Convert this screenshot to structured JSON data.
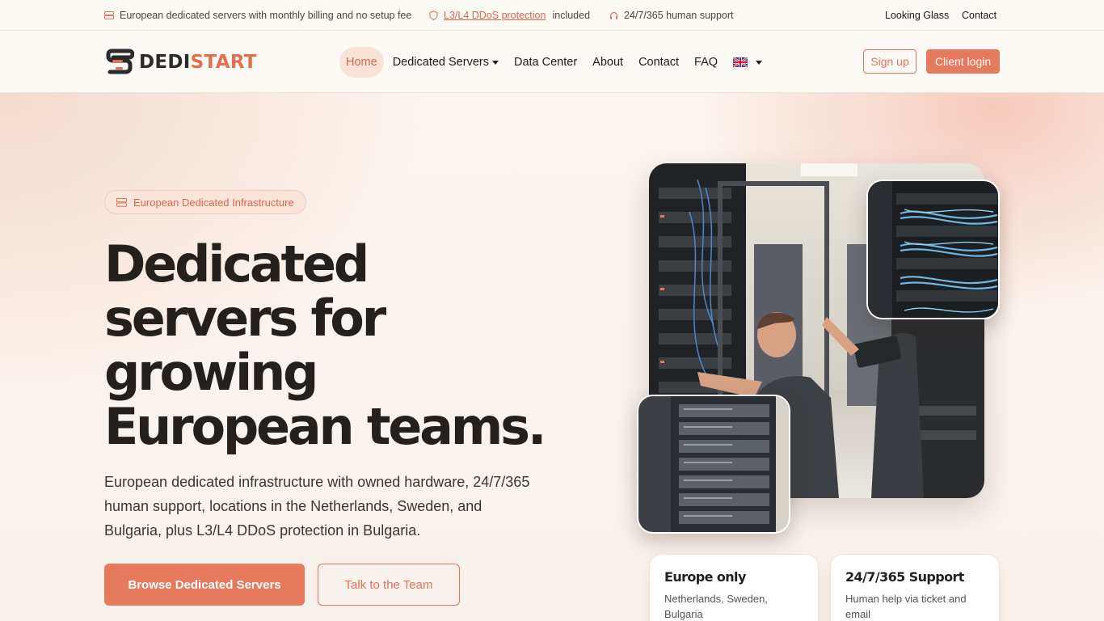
{
  "topbar": {
    "item1": "European dedicated servers with monthly billing and no setup fee",
    "ddos_link": "L3/L4 DDoS protection",
    "ddos_suffix": "included",
    "support": "24/7/365 human support",
    "looking_glass": "Looking Glass",
    "contact": "Contact"
  },
  "logo": {
    "part1": "DEDI",
    "part2": "START"
  },
  "nav": {
    "home": "Home",
    "dedicated_servers": "Dedicated Servers",
    "data_center": "Data Center",
    "about": "About",
    "contact": "Contact",
    "faq": "FAQ",
    "language_icon": "uk-flag-icon"
  },
  "auth": {
    "signup": "Sign up",
    "login": "Client login"
  },
  "hero": {
    "badge": "European Dedicated Infrastructure",
    "headline_line1": "Dedicated",
    "headline_line2": "servers for",
    "headline_line3": "growing",
    "headline_line4": "European teams.",
    "lead": "European dedicated infrastructure with owned hardware, 24/7/365 human support, locations in the Netherlands, Sweden, and Bulgaria, plus L3/L4 DDoS protection in Bulgaria.",
    "primary_cta": "Browse Dedicated Servers",
    "secondary_cta": "Talk to the Team"
  },
  "cards": [
    {
      "title": "Europe only",
      "text": "Netherlands, Sweden, Bulgaria"
    },
    {
      "title": "24/7/365 Support",
      "text": "Human help via ticket and email"
    }
  ],
  "colors": {
    "accent": "#e57a5c",
    "text": "#24201d",
    "badge_bg": "#fbe4da"
  }
}
